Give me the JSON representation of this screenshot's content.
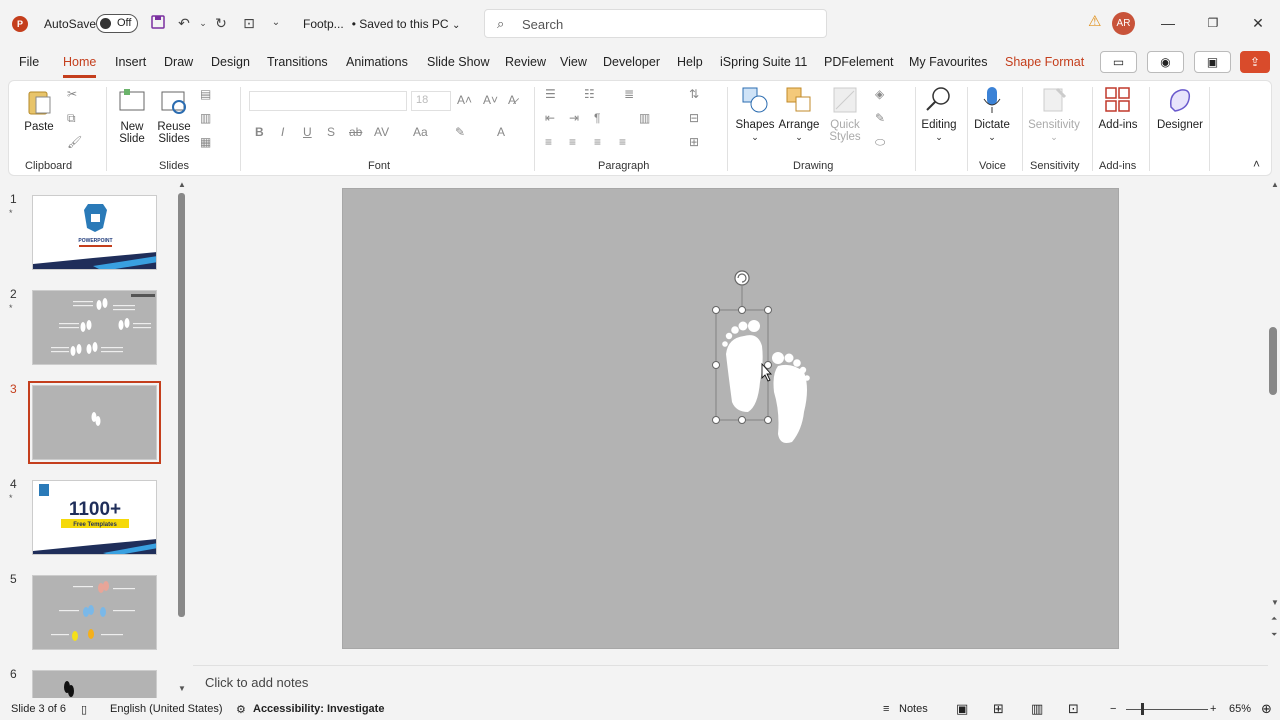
{
  "titlebar": {
    "autosave_label": "AutoSave",
    "autosave_state": "Off",
    "doc_name": "Footp...",
    "saved_status": "• Saved to this PC",
    "search_placeholder": "Search",
    "avatar_initials": "AR"
  },
  "tabs": [
    "File",
    "Home",
    "Insert",
    "Draw",
    "Design",
    "Transitions",
    "Animations",
    "Slide Show",
    "Review",
    "View",
    "Developer",
    "Help",
    "iSpring Suite 11",
    "PDFelement",
    "My Favourites",
    "Shape Format"
  ],
  "ribbon": {
    "clipboard": {
      "paste": "Paste",
      "group": "Clipboard"
    },
    "slides": {
      "new_slide": "New",
      "new_slide2": "Slide",
      "reuse": "Reuse",
      "reuse2": "Slides",
      "group": "Slides"
    },
    "font": {
      "size": "18",
      "group": "Font"
    },
    "paragraph": {
      "group": "Paragraph"
    },
    "drawing": {
      "shapes": "Shapes",
      "arrange": "Arrange",
      "quick_styles": "Quick",
      "quick_styles2": "Styles",
      "group": "Drawing"
    },
    "editing": {
      "label": "Editing"
    },
    "voice": {
      "dictate": "Dictate",
      "group": "Voice"
    },
    "sensitivity": {
      "label": "Sensitivity",
      "group": "Sensitivity"
    },
    "addins": {
      "label": "Add-ins",
      "group": "Add-ins"
    },
    "designer": {
      "label": "Designer"
    }
  },
  "slides": [
    {
      "num": "1",
      "star": "*"
    },
    {
      "num": "2",
      "star": "*"
    },
    {
      "num": "3",
      "star": ""
    },
    {
      "num": "4",
      "star": "*"
    },
    {
      "num": "5",
      "star": ""
    },
    {
      "num": "6",
      "star": ""
    }
  ],
  "thumb4": {
    "big": "1100+",
    "sub": "Free Templates"
  },
  "thumb1": {
    "title": "POWERPOINT"
  },
  "notes_placeholder": "Click to add notes",
  "status": {
    "slide": "Slide 3 of 6",
    "language": "English (United States)",
    "accessibility": "Accessibility: Investigate",
    "notes": "Notes",
    "zoom": "65%"
  },
  "colors": {
    "accent": "#c43e1c",
    "slide_bg": "#b3b3b3"
  }
}
